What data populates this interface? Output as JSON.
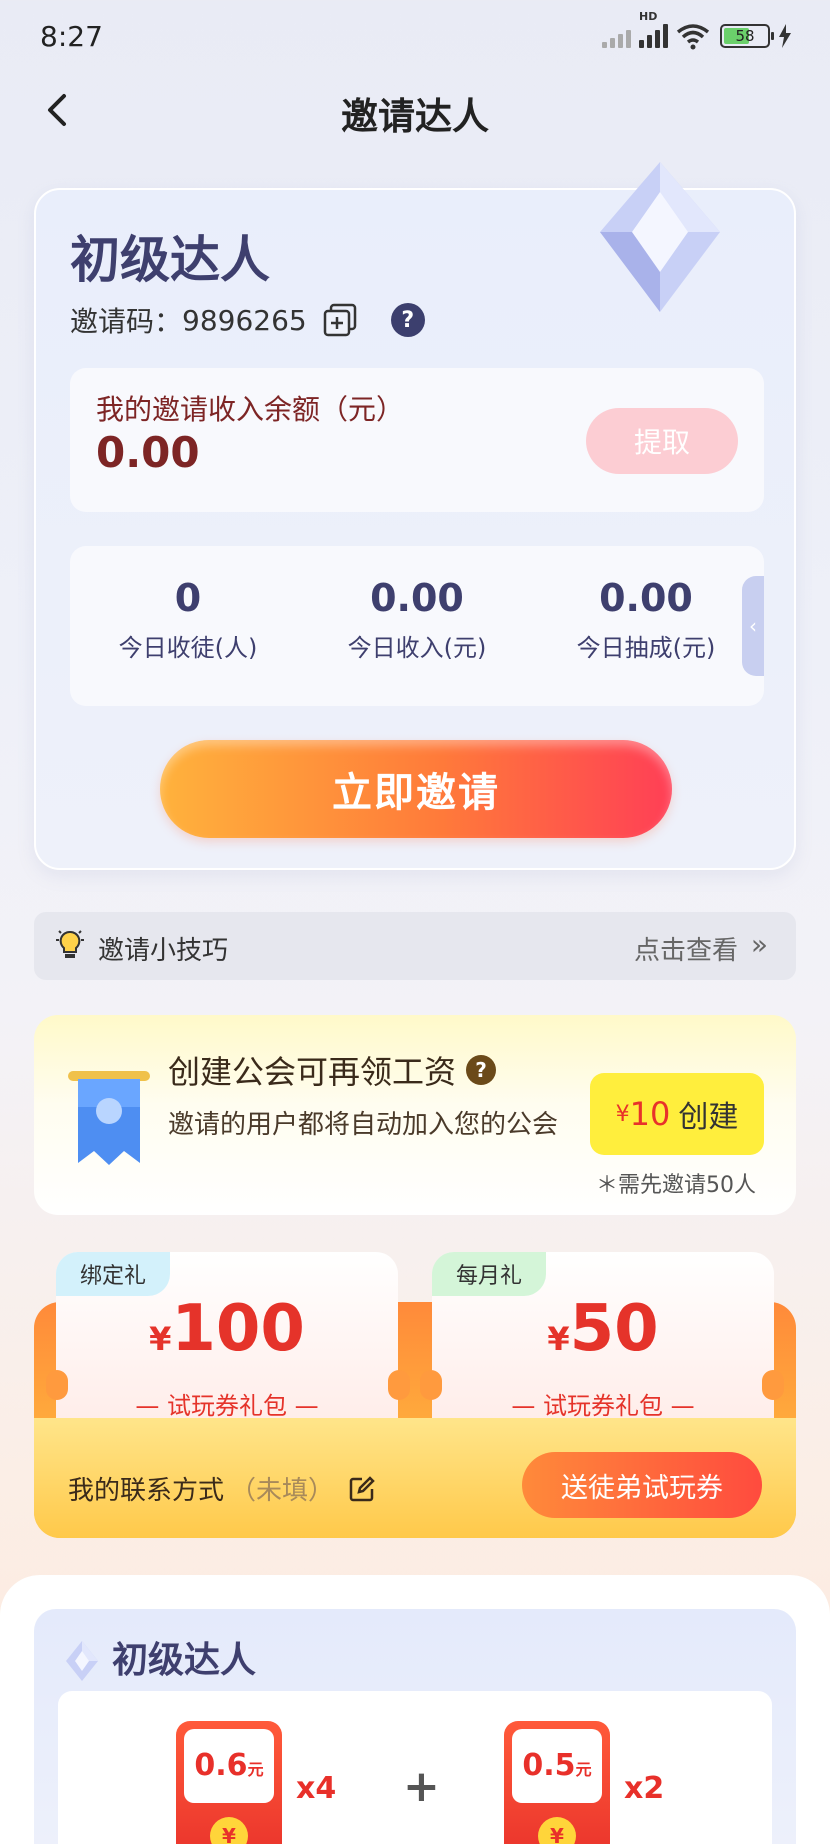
{
  "status_bar": {
    "time": "8:27",
    "hd": "HD",
    "battery": "58"
  },
  "nav": {
    "title": "邀请达人"
  },
  "main_card": {
    "level_title": "初级达人",
    "invite_code_label": "邀请码：",
    "invite_code": "9896265",
    "balance_label": "我的邀请收入余额（元）",
    "balance_value": "0.00",
    "withdraw_label": "提取",
    "stats": [
      {
        "value": "0",
        "label": "今日收徒(人)"
      },
      {
        "value": "0.00",
        "label": "今日收入(元)"
      },
      {
        "value": "0.00",
        "label": "今日抽成(元)"
      }
    ],
    "invite_button": "立即邀请"
  },
  "tips": {
    "label": "邀请小技巧",
    "link": "点击查看"
  },
  "guild": {
    "title": "创建公会可再领工资",
    "description": "邀请的用户都将自动加入您的公会",
    "create_currency": "¥",
    "create_amount": "10",
    "create_label": "创建",
    "note": "＊需先邀请50人"
  },
  "gifts": {
    "coupons": [
      {
        "tag": "绑定礼",
        "currency": "¥",
        "amount": "100",
        "subtitle": "— 试玩券礼包 —",
        "tag_color": "#d3f1fb"
      },
      {
        "tag": "每月礼",
        "currency": "¥",
        "amount": "50",
        "subtitle": "— 试玩券礼包 —",
        "tag_color": "#d4f5d8"
      }
    ],
    "contact_label": "我的联系方式",
    "contact_status": "（未填）",
    "send_button": "送徒弟试玩券"
  },
  "level_section": {
    "title": "初级达人",
    "rewards": [
      {
        "value": "0.6",
        "unit": "元",
        "coin": "¥",
        "multiplier": "x4"
      },
      {
        "value": "0.5",
        "unit": "元",
        "coin": "¥",
        "multiplier": "x2"
      }
    ],
    "plus": "+"
  },
  "colors": {
    "accent_dark": "#3e3f6e",
    "balance": "#7d2525",
    "red": "#e5332a"
  }
}
